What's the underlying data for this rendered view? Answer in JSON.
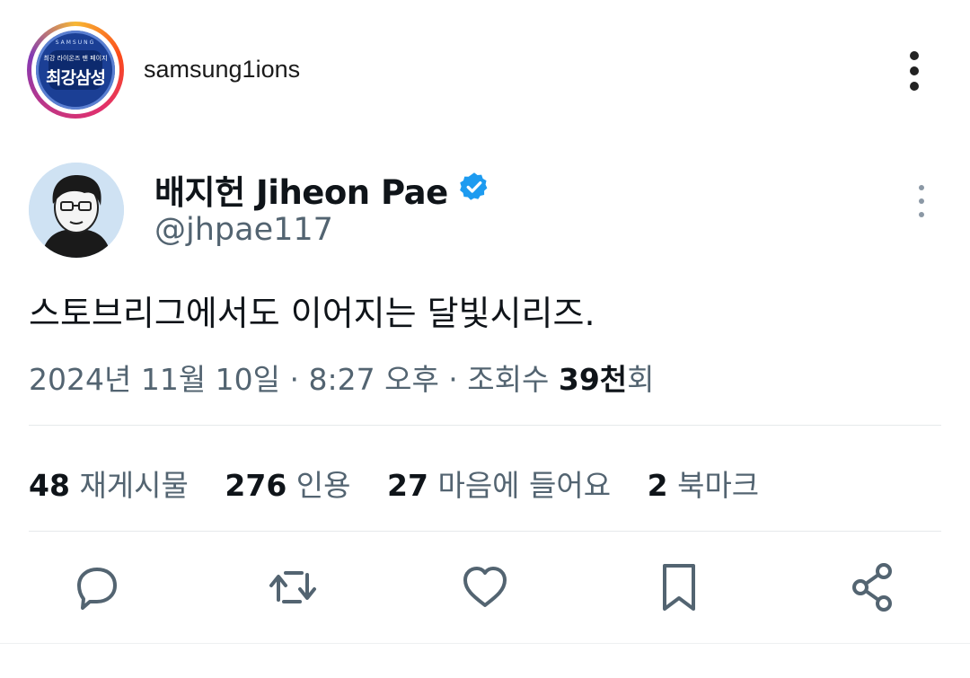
{
  "post": {
    "username": "samsung1ions",
    "avatar_logo": {
      "top_text": "SAMSUNG",
      "line1": "최강 라이온즈 팬 페이지",
      "line2": "최강삼성",
      "icon": "samsung-lions-fanpage-logo"
    }
  },
  "tweet": {
    "name": "배지헌 Jiheon Pae",
    "handle": "@jhpae117",
    "text": "스토브리그에서도 이어지는 달빛시리즈.",
    "meta_prefix": "2024년 11월 10일 · 8:27 오후 · 조회수 ",
    "views": "39천",
    "views_suffix": "회",
    "stats": [
      {
        "count": "48",
        "label": "재게시물"
      },
      {
        "count": "276",
        "label": "인용"
      },
      {
        "count": "27",
        "label": "마음에 들어요"
      },
      {
        "count": "2",
        "label": "북마크"
      }
    ],
    "actions": [
      {
        "icon": "reply-icon"
      },
      {
        "icon": "retweet-icon"
      },
      {
        "icon": "like-icon"
      },
      {
        "icon": "bookmark-icon"
      },
      {
        "icon": "share-icon"
      }
    ]
  },
  "colors": {
    "text_primary": "#0f1419",
    "text_secondary": "#536471",
    "verified_blue": "#1d9bf0",
    "icon_gray": "#536471"
  }
}
